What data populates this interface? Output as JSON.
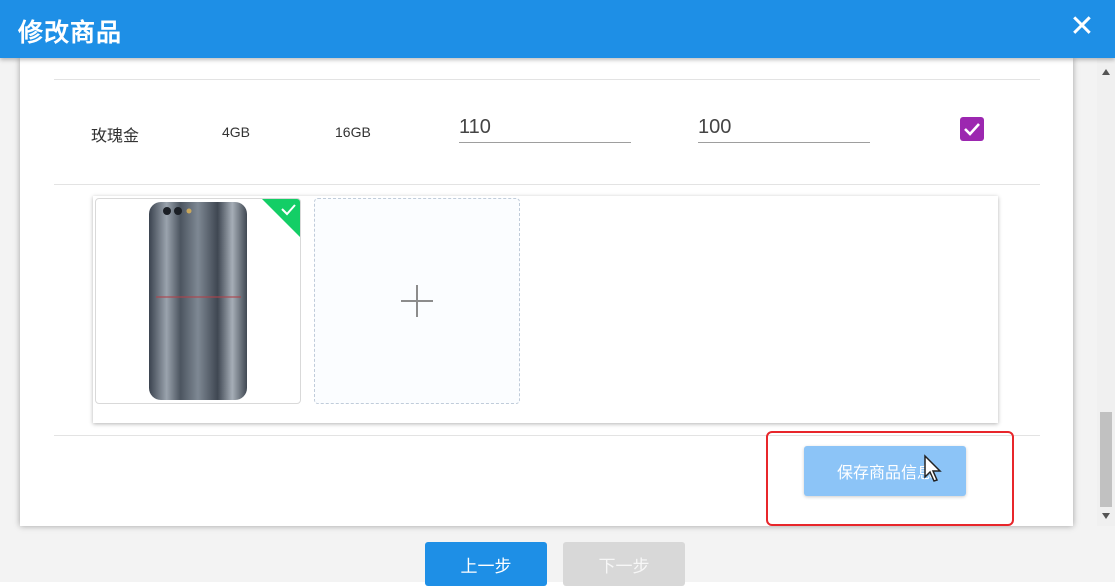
{
  "dialog": {
    "title": "修改商品",
    "close_icon": "close-icon"
  },
  "sku_row": {
    "color": "玫瑰金",
    "ram": "4GB",
    "storage": "16GB",
    "price": "110",
    "stock": "100",
    "enabled": true
  },
  "images": {
    "uploaded_count": 1,
    "add_icon": "plus-icon",
    "uploaded_badge_icon": "check-icon"
  },
  "actions": {
    "save_label": "保存商品信息",
    "prev_label": "上一步",
    "next_label": "下一步"
  },
  "colors": {
    "header": "#1e8fe6",
    "checkbox": "#9c27b0",
    "upload_badge": "#13ce66",
    "save_button": "#8cc4f7",
    "highlight_box": "#e8262b"
  }
}
